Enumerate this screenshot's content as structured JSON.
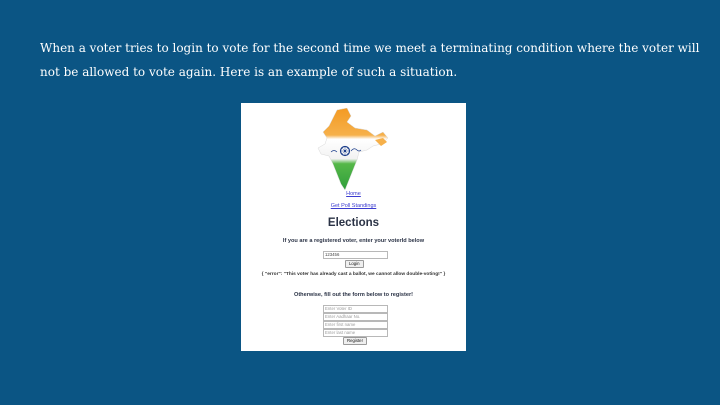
{
  "slide": {
    "text": "When a voter tries to login to vote for the second time we meet a terminating condition where the voter will not be allowed to vote again. Here is an example of such a situation."
  },
  "app": {
    "nav": {
      "home": "Home",
      "poll_standings": "Get Poll Standings"
    },
    "title": "Elections",
    "login": {
      "prompt": "If you are a registered voter, enter your voterId below",
      "voter_id_value": "123456",
      "button": "Login"
    },
    "error_message": "{ \"error\": \"This voter has already cast a ballot, we cannot allow double-voting!\" }",
    "register": {
      "prompt": "Otherwise, fill out the form below to register!",
      "voter_id_placeholder": "Enter Voter ID",
      "aadhaar_placeholder": "Enter Aadhaar No.",
      "first_name_placeholder": "Enter first name",
      "last_name_placeholder": "Enter last name",
      "button": "Register"
    },
    "colors": {
      "saffron": "#f39a22",
      "green": "#2f9e3b",
      "chakra": "#1b3d8a"
    }
  }
}
